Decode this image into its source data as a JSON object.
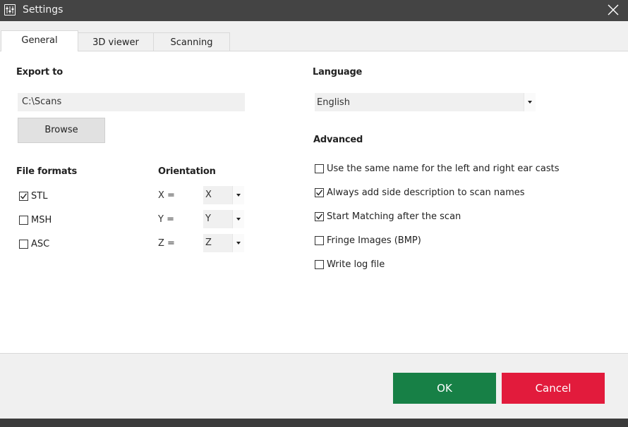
{
  "window": {
    "title": "Settings"
  },
  "tabs": [
    {
      "label": "General",
      "active": true
    },
    {
      "label": "3D viewer",
      "active": false
    },
    {
      "label": "Scanning",
      "active": false
    }
  ],
  "export": {
    "heading": "Export to",
    "path": "C:\\Scans",
    "browse_label": "Browse"
  },
  "file_formats": {
    "heading": "File formats",
    "items": [
      {
        "label": "STL",
        "checked": true
      },
      {
        "label": "MSH",
        "checked": false
      },
      {
        "label": "ASC",
        "checked": false
      }
    ]
  },
  "orientation": {
    "heading": "Orientation",
    "axes": [
      {
        "label": "X =",
        "value": "X"
      },
      {
        "label": "Y =",
        "value": "Y"
      },
      {
        "label": "Z =",
        "value": "Z"
      }
    ]
  },
  "language": {
    "heading": "Language",
    "value": "English"
  },
  "advanced": {
    "heading": "Advanced",
    "items": [
      {
        "label": "Use the same name for the left and right ear casts",
        "checked": false
      },
      {
        "label": "Always add side description to scan names",
        "checked": true
      },
      {
        "label": "Start Matching after the scan",
        "checked": true
      },
      {
        "label": "Fringe Images (BMP)",
        "checked": false
      },
      {
        "label": "Write log file",
        "checked": false
      }
    ]
  },
  "footer": {
    "ok_label": "OK",
    "cancel_label": "Cancel"
  },
  "colors": {
    "titlebar": "#444444",
    "ok": "#178046",
    "cancel": "#e21b3c"
  },
  "icons": {
    "app": "sliders-icon",
    "close": "close-icon",
    "check": "checkmark-icon",
    "dropdown": "chevron-down-icon"
  }
}
